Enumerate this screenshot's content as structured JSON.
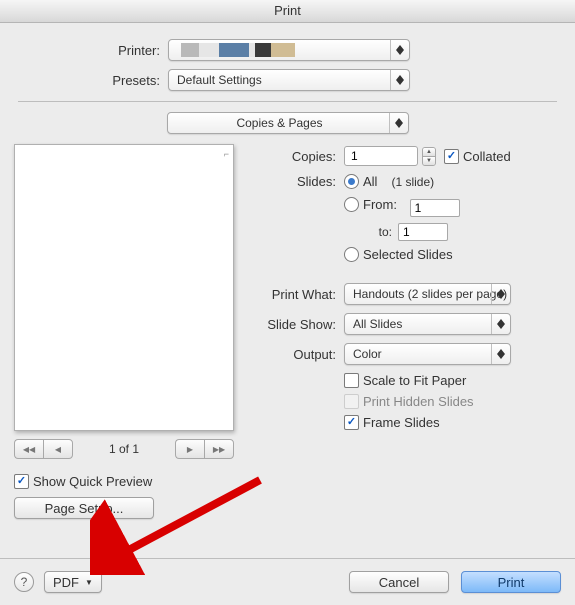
{
  "title": "Print",
  "printer_label": "Printer:",
  "presets_label": "Presets:",
  "presets_value": "Default Settings",
  "section_value": "Copies & Pages",
  "copies_label": "Copies:",
  "copies_value": "1",
  "collated_label": "Collated",
  "slides_label": "Slides:",
  "radio_all": "All",
  "slide_count": "(1 slide)",
  "radio_from": "From:",
  "from_value": "1",
  "to_label": "to:",
  "to_value": "1",
  "radio_selected": "Selected Slides",
  "printwhat_label": "Print What:",
  "printwhat_value": "Handouts (2 slides per page)",
  "slideshow_label": "Slide Show:",
  "slideshow_value": "All Slides",
  "output_label": "Output:",
  "output_value": "Color",
  "scale_label": "Scale to Fit Paper",
  "hidden_label": "Print Hidden Slides",
  "frame_label": "Frame Slides",
  "page_indicator": "1 of 1",
  "quick_preview": "Show Quick Preview",
  "page_setup": "Page Setup...",
  "pdf_label": "PDF",
  "cancel_label": "Cancel",
  "print_label": "Print"
}
